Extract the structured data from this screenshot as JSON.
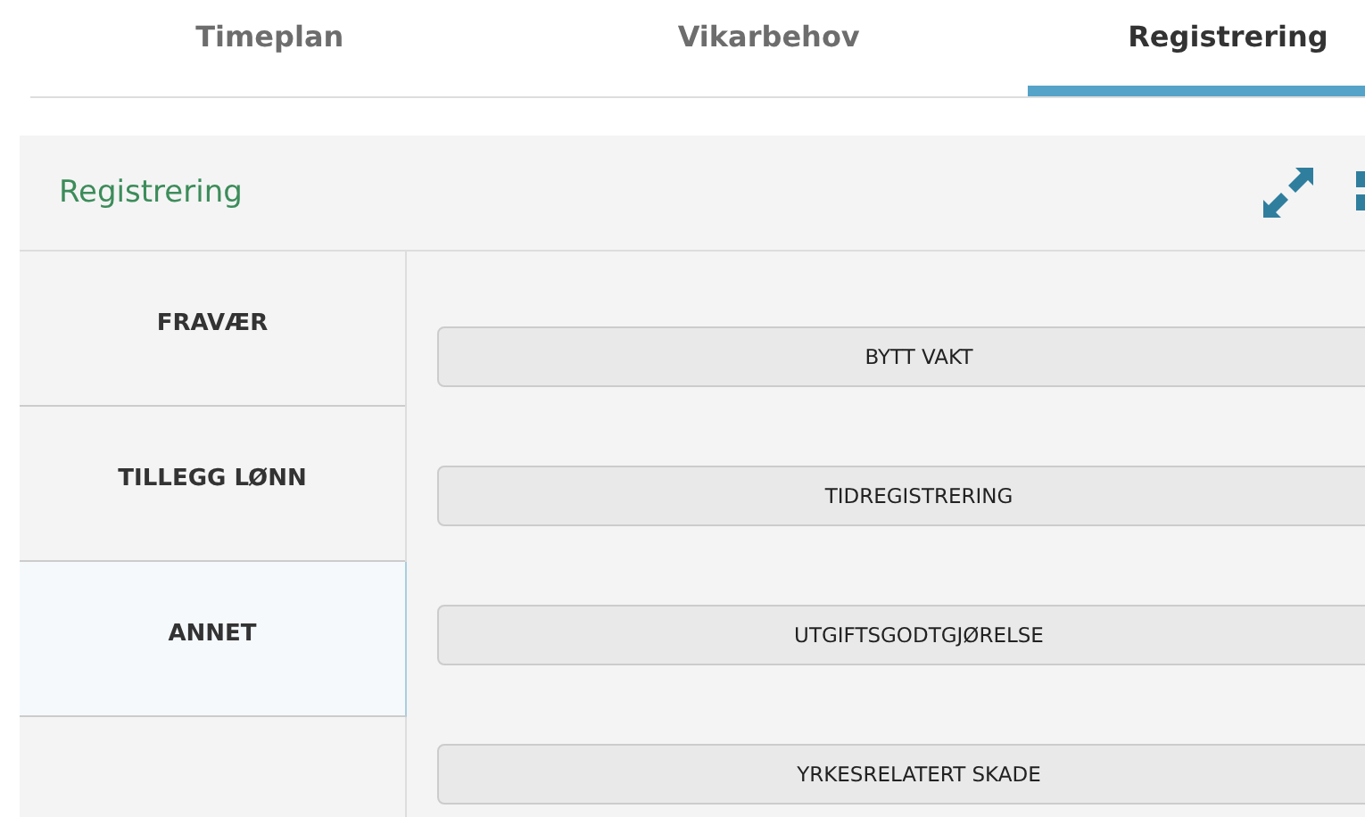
{
  "tabs": [
    {
      "label": "Timeplan",
      "selected": false
    },
    {
      "label": "Vikarbehov",
      "selected": false
    },
    {
      "label": "Registrering",
      "selected": true
    }
  ],
  "panel": {
    "title": "Registrering"
  },
  "sidebar": {
    "items": [
      {
        "label": "FRAVÆR",
        "selected": false
      },
      {
        "label": "TILLEGG LØNN",
        "selected": false
      },
      {
        "label": "ANNET",
        "selected": true
      }
    ]
  },
  "buttons": [
    "BYTT VAKT",
    "TIDREGISTRERING",
    "UTGIFTSGODTGJØRELSE",
    "YRKESRELATERT SKADE"
  ]
}
